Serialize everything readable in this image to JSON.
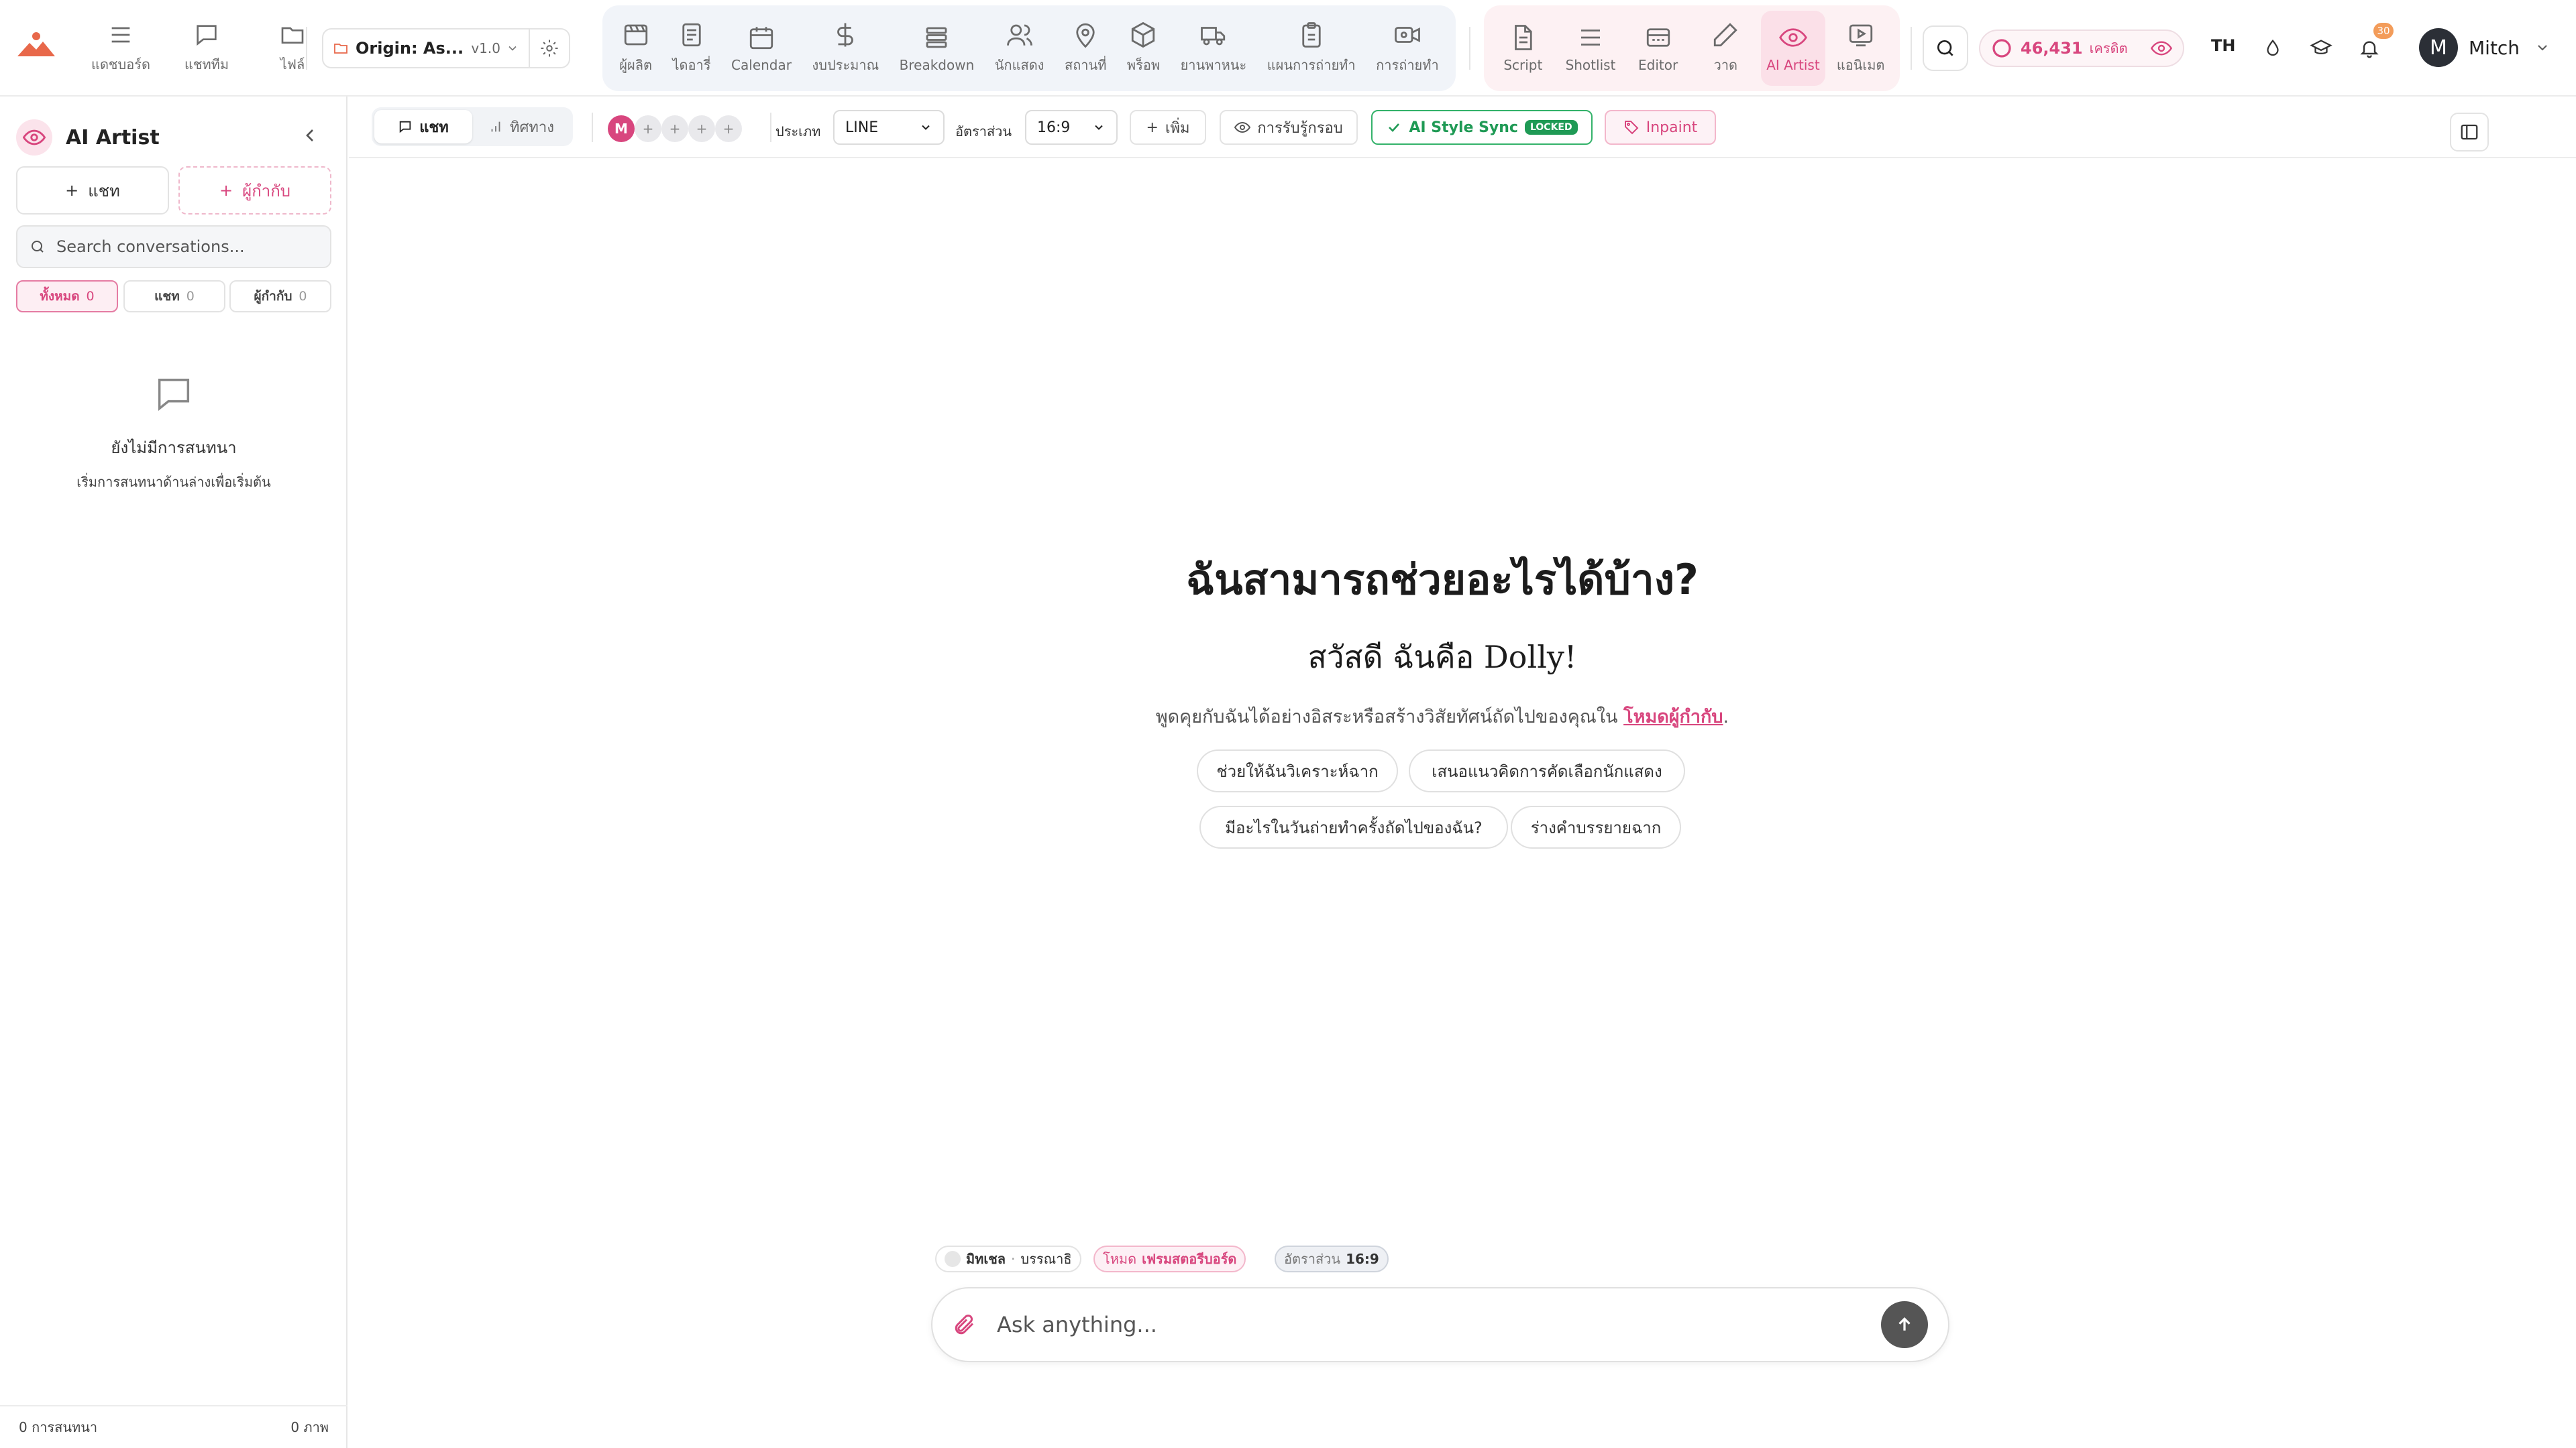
{
  "colors": {
    "accent": "#d8467e",
    "success": "#1f9a55",
    "logo": "#e8684a"
  },
  "top": {
    "left_nav": [
      {
        "label": "แดชบอร์ด",
        "icon": "menu-icon"
      },
      {
        "label": "แชททีม",
        "icon": "chat-icon"
      },
      {
        "label": "ไฟล์",
        "icon": "folder-icon"
      }
    ],
    "project": {
      "name": "Origin: As...",
      "version": "v1.0"
    },
    "prod_nav": [
      {
        "label": "ผู้ผลิต",
        "icon": "clapper-icon"
      },
      {
        "label": "ไดอารี่",
        "icon": "document-icon"
      },
      {
        "label": "Calendar",
        "icon": "calendar-icon"
      },
      {
        "label": "งบประมาณ",
        "icon": "dollar-icon"
      },
      {
        "label": "Breakdown",
        "icon": "layers-icon"
      },
      {
        "label": "นักแสดง",
        "icon": "users-icon"
      },
      {
        "label": "สถานที่",
        "icon": "map-pin-icon"
      },
      {
        "label": "พร็อพ",
        "icon": "box-icon"
      },
      {
        "label": "ยานพาหนะ",
        "icon": "truck-icon"
      },
      {
        "label": "แผนการถ่ายทำ",
        "icon": "clipboard-icon"
      },
      {
        "label": "การถ่ายทำ",
        "icon": "camera-icon"
      }
    ],
    "creative_nav": [
      {
        "label": "Script",
        "icon": "script-icon"
      },
      {
        "label": "Shotlist",
        "icon": "list-icon"
      },
      {
        "label": "Editor",
        "icon": "editor-icon"
      },
      {
        "label": "วาด",
        "icon": "pencil-icon"
      },
      {
        "label": "AI Artist",
        "icon": "eye-icon",
        "active": true
      },
      {
        "label": "แอนิเมต",
        "icon": "play-icon"
      }
    ],
    "credits": {
      "value": "46,431",
      "unit": "เครดิต"
    },
    "language": "TH",
    "notifications": "30",
    "user": {
      "initial": "M",
      "name": "Mitch"
    }
  },
  "sidebar": {
    "title": "AI Artist",
    "new_chat": "แชท",
    "new_director": "ผู้กำกับ",
    "search_placeholder": "Search conversations...",
    "filters": [
      {
        "label": "ทั้งหมด",
        "count": "0"
      },
      {
        "label": "แชท",
        "count": "0"
      },
      {
        "label": "ผู้กำกับ",
        "count": "0"
      }
    ],
    "empty_title": "ยังไม่มีการสนทนา",
    "empty_sub": "เริ่มการสนทนาด้านล่างเพื่อเริ่มต้น",
    "footer_left": "0 การสนทนา",
    "footer_right": "0 ภาพ"
  },
  "toolbar": {
    "mode_chat": "แชท",
    "mode_direction": "ทิศทาง",
    "collab_initial": "M",
    "type_label": "ประเภท",
    "type_value": "LINE",
    "ratio_label": "อัตราส่วน",
    "ratio_value": "16:9",
    "add_label": "เพิ่ม",
    "perception_label": "การรับรู้กรอบ",
    "style_sync_label": "AI Style Sync",
    "locked_label": "LOCKED",
    "inpaint_label": "Inpaint"
  },
  "main": {
    "heading": "ฉันสามารถช่วยอะไรได้บ้าง?",
    "greeting": "สวัสดี ฉันคือ Dolly!",
    "desc_prefix": "พูดคุยกับฉันได้อย่างอิสระหรือสร้างวิสัยทัศน์ถัดไปของคุณใน",
    "desc_link": "โหมดผู้กำกับ",
    "desc_suffix": ".",
    "suggestions": [
      "ช่วยให้ฉันวิเคราะห์ฉาก",
      "เสนอแนวคิดการคัดเลือกนักแสดง",
      "มีอะไรในวันถ่ายทำครั้งถัดไปของฉัน?",
      "ร่างคำบรรยายฉาก"
    ]
  },
  "composer": {
    "ctx_user": "มิทเชล",
    "ctx_role": "บรรณาธิ",
    "ctx_mode_prefix": "โหมด",
    "ctx_mode_value": "เฟรมสตอรีบอร์ด",
    "ctx_ratio_label": "อัตราส่วน",
    "ctx_ratio_value": "16:9",
    "placeholder": "Ask anything..."
  }
}
